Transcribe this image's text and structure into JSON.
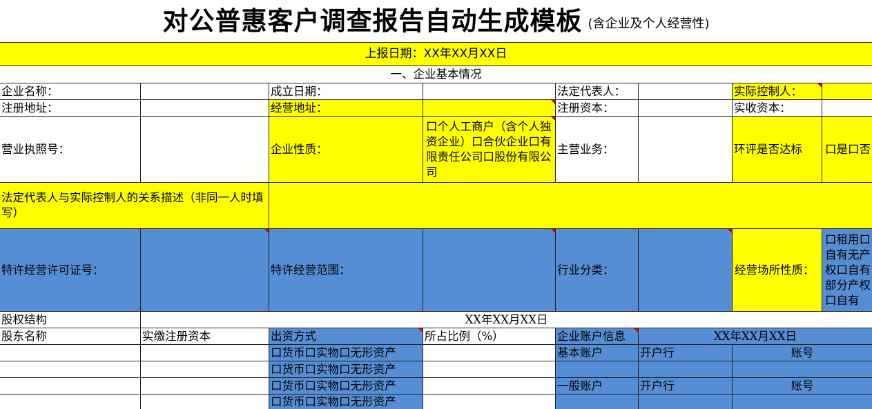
{
  "title": {
    "main": "对公普惠客户调查报告自动生成模板",
    "sub": "(含企业及个人经营性)"
  },
  "report_date": "上报日期：XX年XX月XX日",
  "section1": "一、企业基本情况",
  "row1": {
    "company_name": "企业名称：",
    "founded": "成立日期：",
    "legal_rep": "法定代表人：",
    "controller": "实际控制人："
  },
  "row2": {
    "reg_addr": "注册地址：",
    "biz_addr": "经营地址：",
    "reg_capital": "注册资本：",
    "paid_capital": "实收资本："
  },
  "row3": {
    "license": "营业执照号：",
    "nature_label": "企业性质：",
    "nature_options": "口个人工商户（含个人独资企业）口合伙企业口有限责任公司口股份有限公司",
    "main_biz": "主营业务：",
    "env_label": "环评是否达标",
    "env_options": "口是口否"
  },
  "row4": {
    "relation": "法定代表人与实际控制人的关系描述（非同一人时填写）"
  },
  "row5": {
    "franchise_no": "特许经营许可证号：",
    "franchise_scope": "特许经营范围：",
    "industry": "行业分类：",
    "premises_label": "经营场所性质：",
    "premises_options": "口租用口自有无产权口自有部分产权口自有"
  },
  "equity": {
    "label": "股权结构",
    "date": "XX年XX月XX日"
  },
  "equity_header": {
    "shareholder": "股东名称",
    "paid_capital": "实缴注册资本",
    "contribution": "出资方式",
    "ratio": "所占比例（%）",
    "account_info": "企业账户信息",
    "account_date": "XX年XX月XX日"
  },
  "contribution_option": "口货币口实物口无形资产",
  "accounts": {
    "basic": "基本账户",
    "general": "一般账户",
    "bank": "开户行",
    "number": "账号"
  }
}
